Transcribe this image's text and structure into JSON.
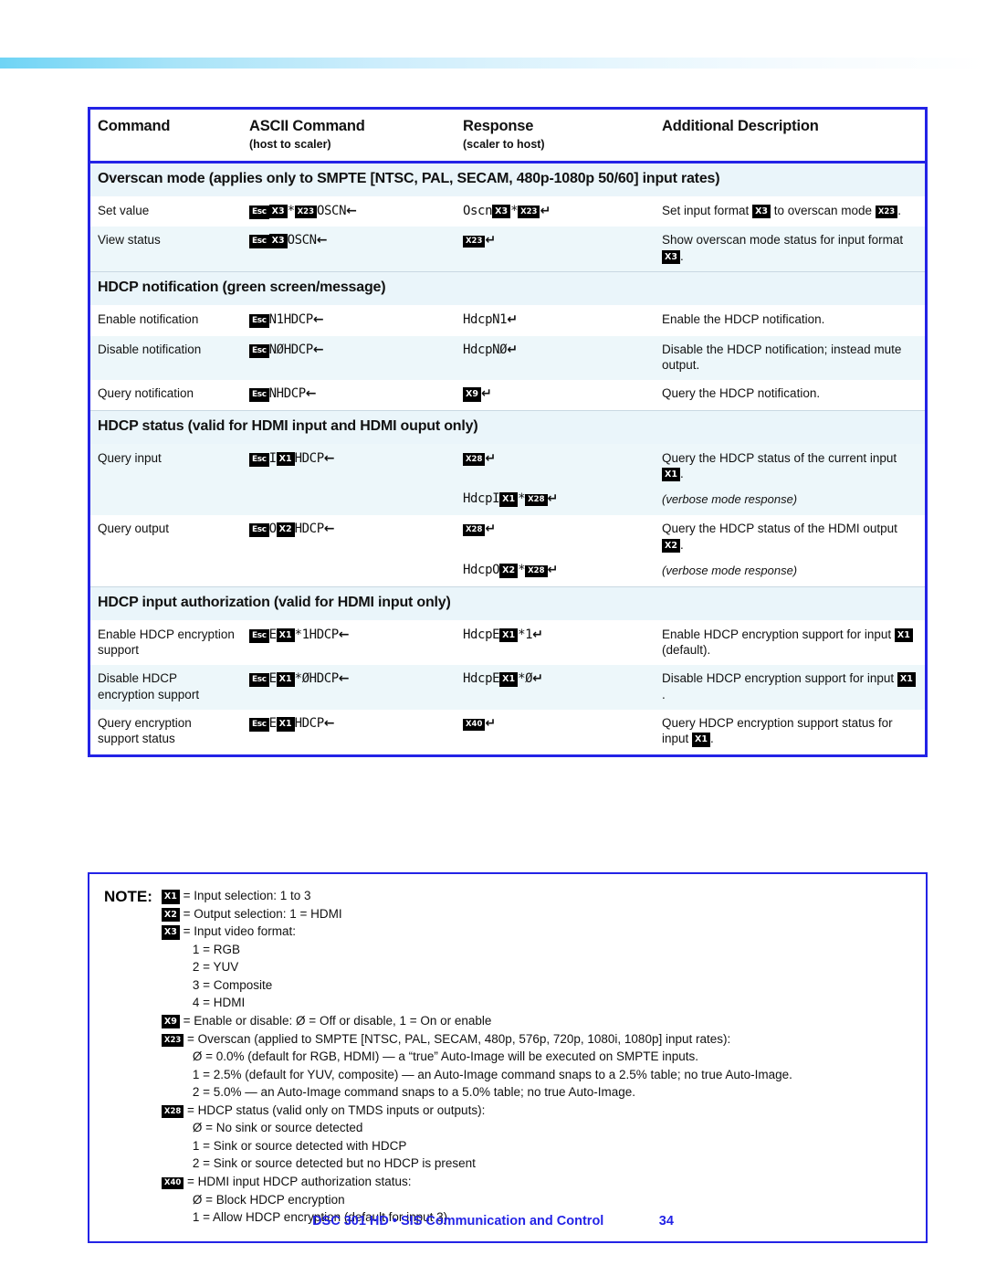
{
  "document": {
    "footer_title": "DSC 301 HD • SIS Communication and Control",
    "page_number": "34",
    "accent_color": "#2323e6",
    "row_tint_color": "#edf7fa"
  },
  "table": {
    "headers": [
      {
        "title": "Command",
        "sub": ""
      },
      {
        "title": "ASCII Command",
        "sub": "(host to scaler)"
      },
      {
        "title": "Response",
        "sub": "(scaler to host)"
      },
      {
        "title": "Additional Description",
        "sub": ""
      }
    ],
    "sections": [
      {
        "heading": "Overscan mode (applies only to SMPTE [NTSC, PAL, SECAM, 480p-1080p 50/60] input rates)",
        "rows": [
          {
            "command": "Set value",
            "ascii": "Esc X3 * X23 OSCN ←",
            "response": "Oscn X3 * X23 ↵",
            "description": "Set input format X3 to overscan mode X23."
          },
          {
            "command": "View status",
            "ascii": "Esc X3 OSCN ←",
            "response": "X23 ↵",
            "description": "Show overscan mode status for input format X3."
          }
        ]
      },
      {
        "heading": "HDCP notification (green screen/message)",
        "rows": [
          {
            "command": "Enable notification",
            "ascii": "Esc N1HDCP ←",
            "response": "HdcpN1 ↵",
            "description": "Enable the HDCP notification."
          },
          {
            "command": "Disable notification",
            "ascii": "Esc NØHDCP ←",
            "response": "HdcpNØ ↵",
            "description": "Disable the HDCP notification; instead mute output."
          },
          {
            "command": "Query notification",
            "ascii": "Esc NHDCP ←",
            "response": "X9 ↵",
            "description": "Query the HDCP notification."
          }
        ]
      },
      {
        "heading": "HDCP status (valid for HDMI input and HDMI ouput only)",
        "rows": [
          {
            "command": "Query input",
            "ascii": "Esc I X1 HDCP ←",
            "response": "X28 ↵",
            "response_verbose": "HdcpI X1 * X28 ↵",
            "description": "Query the HDCP status of the current input X1.",
            "description_verbose": "(verbose mode response)"
          },
          {
            "command": "Query output",
            "ascii": "Esc O X2 HDCP ←",
            "response": "X28 ↵",
            "response_verbose": "HdcpO X2 * X28 ↵",
            "description": "Query the HDCP status of the HDMI output X2.",
            "description_verbose": "(verbose mode response)"
          }
        ]
      },
      {
        "heading": "HDCP input authorization (valid for HDMI input only)",
        "rows": [
          {
            "command": "Enable HDCP encryption support",
            "ascii": "Esc E X1 *1HDCP ←",
            "response": "HdcpE X1 *1 ↵",
            "description": "Enable HDCP encryption support for input X1 (default)."
          },
          {
            "command": "Disable HDCP encryption support",
            "ascii": "Esc E X1 *ØHDCP ←",
            "response": "HdcpE X1 *Ø ↵",
            "description": "Disable HDCP encryption support for input X1."
          },
          {
            "command": "Query encryption support status",
            "ascii": "Esc E X1 HDCP ←",
            "response": "X40 ↵",
            "description": "Query HDCP encryption support status for input X1."
          }
        ]
      }
    ]
  },
  "note": {
    "label": "NOTE:",
    "entries": [
      {
        "token": "X1",
        "text": "= Input selection: 1 to 3"
      },
      {
        "token": "X2",
        "text": "= Output selection: 1 = HDMI"
      },
      {
        "token": "X3",
        "text": "= Input video format:"
      },
      {
        "token": "",
        "text": "1 = RGB",
        "indent": 1
      },
      {
        "token": "",
        "text": "2 = YUV",
        "indent": 1
      },
      {
        "token": "",
        "text": "3 = Composite",
        "indent": 1
      },
      {
        "token": "",
        "text": "4 = HDMI",
        "indent": 1
      },
      {
        "token": "X9",
        "text": "= Enable or disable: Ø = Off or disable, 1 = On or enable"
      },
      {
        "token": "X23",
        "text": "= Overscan (applied to SMPTE [NTSC, PAL, SECAM, 480p, 576p, 720p, 1080i, 1080p] input rates):"
      },
      {
        "token": "",
        "text": "Ø = 0.0% (default for RGB, HDMI) — a “true” Auto-Image will be executed on SMPTE inputs.",
        "indent": 1
      },
      {
        "token": "",
        "text": "1 = 2.5% (default for YUV, composite) — an Auto-Image command snaps to a 2.5% table; no true Auto-Image.",
        "indent": 1
      },
      {
        "token": "",
        "text": "2 = 5.0% — an Auto-Image command snaps to a 5.0% table; no true Auto-Image.",
        "indent": 1
      },
      {
        "token": "X28",
        "text": "= HDCP status (valid only on TMDS inputs or outputs):"
      },
      {
        "token": "",
        "text": "Ø = No sink or source detected",
        "indent": 1
      },
      {
        "token": "",
        "text": "1 = Sink or source detected with HDCP",
        "indent": 1
      },
      {
        "token": "",
        "text": "2 = Sink or source detected but no HDCP is present",
        "indent": 1
      },
      {
        "token": "X40",
        "text": "= HDMI input HDCP authorization status:"
      },
      {
        "token": "",
        "text": "Ø = Block HDCP encryption",
        "indent": 1
      },
      {
        "token": "",
        "text": "1 = Allow HDCP encryption (default for input 3)",
        "indent": 1
      }
    ]
  }
}
